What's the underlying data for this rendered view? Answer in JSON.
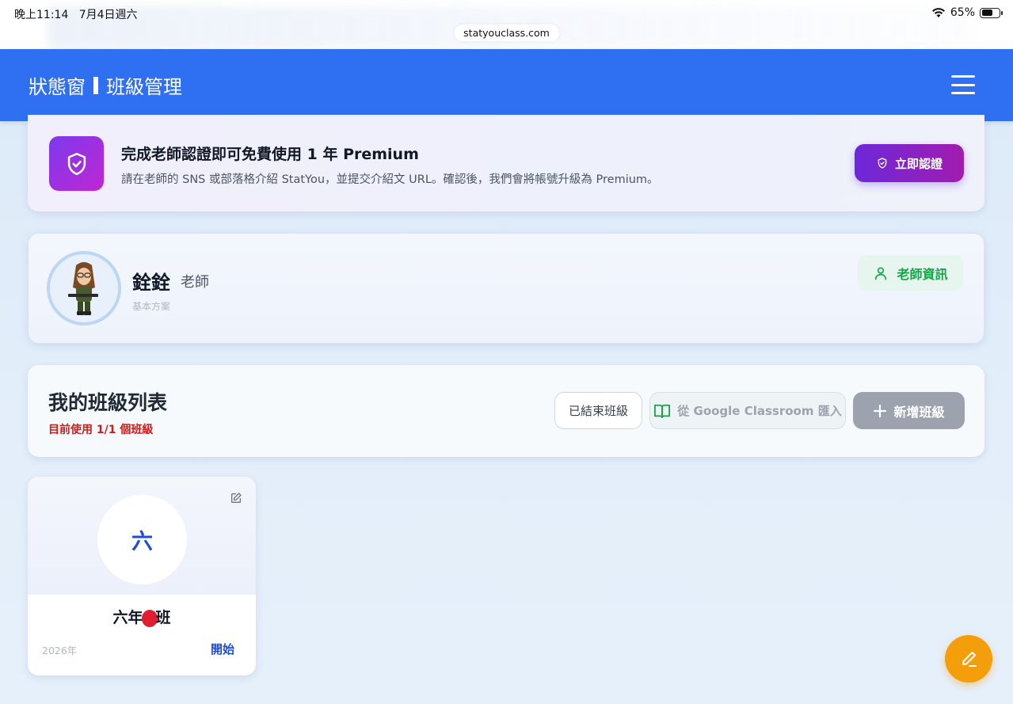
{
  "status_bar": {
    "time": "晚上11:14",
    "date": "7月4日週六",
    "battery": "65%",
    "battery_level": 0.65,
    "url": "statyouclass.com"
  },
  "header": {
    "app_name": "狀態窗",
    "section": "班級管理"
  },
  "premium_banner": {
    "title": "完成老師認證即可免費使用 1 年 Premium",
    "description": "請在老師的 SNS 或部落格介紹 StatYou，並提交介紹文 URL。確認後，我們會將帳號升級為 Premium。",
    "button_label": "立即認證"
  },
  "teacher": {
    "name": "銓銓",
    "role": "老師",
    "plan": "基本方案",
    "info_button": "老師資訊"
  },
  "class_list": {
    "title": "我的班級列表",
    "usage": "目前使用 1/1 個班級",
    "ended_button": "已結束班級",
    "google_button": "從 Google Classroom 匯入",
    "add_button": "新增班級"
  },
  "classes": [
    {
      "badge": "六",
      "name_prefix": "六年",
      "name_suffix": "班",
      "year": "2026年",
      "start_label": "開始"
    }
  ],
  "colors": {
    "header": "#2f6ff2",
    "premium_accent": "#7c3aed",
    "teacher_info": "#16a34a",
    "usage_warning": "#c81e1e",
    "fab": "#f59e0b"
  }
}
